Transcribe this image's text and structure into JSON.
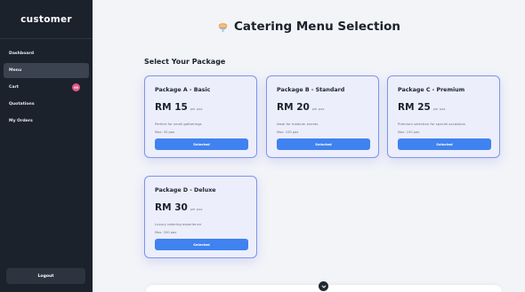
{
  "sidebar": {
    "brand": "customer",
    "items": [
      {
        "label": "Dashboard",
        "active": false
      },
      {
        "label": "Menu",
        "active": true
      },
      {
        "label": "Cart",
        "active": false,
        "badge": "99"
      },
      {
        "label": "Quotations",
        "active": false
      },
      {
        "label": "My Orders",
        "active": false
      }
    ],
    "logout_label": "Logout"
  },
  "header": {
    "title": "Catering Menu Selection",
    "icon": "food-bowl-icon"
  },
  "section_title": "Select Your Package",
  "packages": [
    {
      "name": "Package A - Basic",
      "price": "RM 15",
      "unit": "per pax",
      "description": "Perfect for small gatherings",
      "max": "Max: 50 pax",
      "button": "Selected"
    },
    {
      "name": "Package B - Standard",
      "price": "RM 20",
      "unit": "per pax",
      "description": "Ideal for medium events",
      "max": "Max: 100 pax",
      "button": "Selected"
    },
    {
      "name": "Package C - Premium",
      "price": "RM 25",
      "unit": "per pax",
      "description": "Premium selection for special occasions",
      "max": "Max: 150 pax",
      "button": "Selected"
    },
    {
      "name": "Package D - Deluxe",
      "price": "RM 30",
      "unit": "per pax",
      "description": "Luxury catering experience",
      "max": "Max: 200 pax",
      "button": "Selected"
    }
  ],
  "colors": {
    "sidebar_bg": "#1b222c",
    "accent": "#3f82f0",
    "card_border": "#7f94ea",
    "badge": "#e05a8c"
  }
}
